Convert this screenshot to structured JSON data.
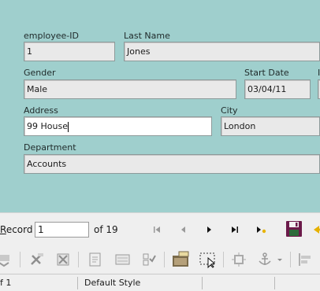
{
  "form": {
    "employee_id": {
      "label": "employee-ID",
      "value": "1"
    },
    "last_name": {
      "label": "Last Name",
      "value": "Jones"
    },
    "gender": {
      "label": "Gender",
      "value": "Male"
    },
    "start_date": {
      "label": "Start Date",
      "value": "03/04/11"
    },
    "address": {
      "label": "Address",
      "value": "99 House"
    },
    "city": {
      "label": "City",
      "value": "London"
    },
    "department": {
      "label": "Department",
      "value": "Accounts"
    }
  },
  "navigation": {
    "record_prefix": "ecord",
    "record_mnemonic": "R",
    "record_value": "1",
    "of_label": "of  19",
    "buttons": [
      "first-record-icon",
      "previous-record-icon",
      "next-record-icon",
      "last-record-icon",
      "new-record-icon",
      "save-record-icon",
      "undo-icon"
    ]
  },
  "toolbar": {
    "icons": [
      "design-mode-icon",
      "control-wizards-icon",
      "form-properties-icon",
      "form-navigator-icon",
      "add-field-icon",
      "activation-order-icon",
      "open-in-design-mode-icon",
      "select-icon",
      "position-size-icon",
      "anchor-icon",
      "align-icon"
    ]
  },
  "status": {
    "page": "f 1",
    "style": "Default Style"
  },
  "colors": {
    "form_background": "#9fcfcd",
    "field_background": "#e9e9e9",
    "chrome": "#efefef"
  }
}
